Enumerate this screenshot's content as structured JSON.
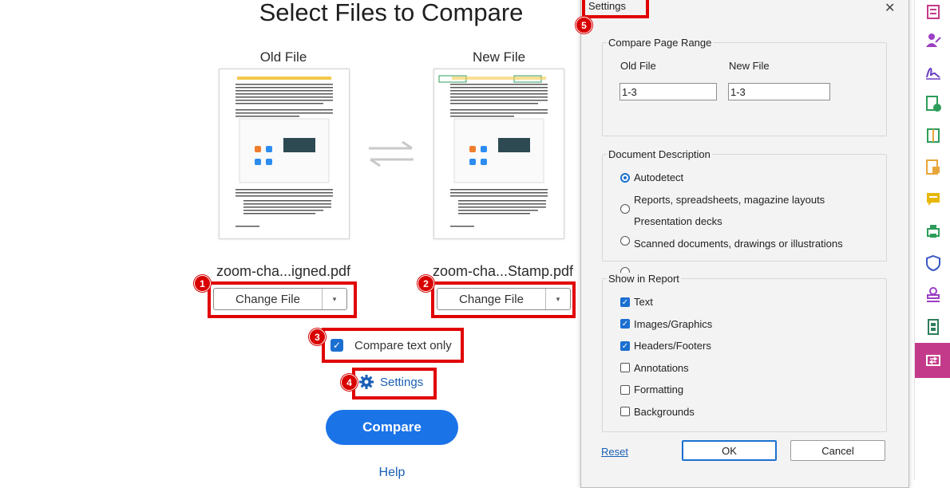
{
  "header": {
    "title": "Select Files to Compare"
  },
  "old_file": {
    "label": "Old File",
    "filename": "zoom-cha...igned.pdf",
    "change_label": "Change File",
    "dropdown_glyph": "▾"
  },
  "new_file": {
    "label": "New File",
    "filename": "zoom-cha...Stamp.pdf",
    "change_label": "Change File",
    "dropdown_glyph": "▾"
  },
  "swap_icon": "swap-arrows-icon",
  "compare_text_only": {
    "label": "Compare text only",
    "checked": true
  },
  "settings_link": {
    "label": "Settings"
  },
  "compare_button": {
    "label": "Compare"
  },
  "help_link": {
    "label": "Help"
  },
  "annotations": [
    "1",
    "2",
    "3",
    "4",
    "5"
  ],
  "dialog": {
    "title": "Settings",
    "close_glyph": "✕",
    "page_range": {
      "group_label": "Compare Page Range",
      "old_label": "Old File",
      "new_label": "New File",
      "old_value": "1-3",
      "new_value": "1-3"
    },
    "description": {
      "group_label": "Document Description",
      "options": [
        {
          "label": "Autodetect",
          "selected": true
        },
        {
          "label": "Reports, spreadsheets, magazine layouts",
          "selected": false
        },
        {
          "label": "Presentation decks",
          "selected": false
        },
        {
          "label": "Scanned documents, drawings or illustrations",
          "selected": false
        }
      ]
    },
    "report": {
      "group_label": "Show in Report",
      "options": [
        {
          "label": "Text",
          "checked": true
        },
        {
          "label": "Images/Graphics",
          "checked": true
        },
        {
          "label": "Headers/Footers",
          "checked": true
        },
        {
          "label": "Annotations",
          "checked": false
        },
        {
          "label": "Formatting",
          "checked": false
        },
        {
          "label": "Backgrounds",
          "checked": false
        }
      ]
    },
    "reset_label": "Reset",
    "ok_label": "OK",
    "cancel_label": "Cancel"
  },
  "colors": {
    "accent": "#1b73e8",
    "annotation_red": "#e00000",
    "active_tool": "#c43a8a"
  },
  "right_rail": [
    "organize-pages-icon",
    "fill-sign-icon",
    "signature-icon",
    "export-pdf-icon",
    "compress-icon",
    "comment-file-icon",
    "comment-icon",
    "print-production-icon",
    "protect-icon",
    "stamp-icon",
    "film-icon",
    "compare-files-icon"
  ]
}
